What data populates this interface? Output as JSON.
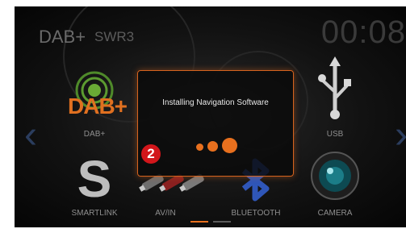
{
  "status_bar": {
    "source": "DAB+",
    "station": "SWR3",
    "time": "00:08"
  },
  "apps": {
    "dab": {
      "logo_text": "DAB+",
      "label": "DAB+"
    },
    "usb": {
      "label": "USB"
    },
    "smartlink": {
      "label": "SMARTLINK"
    },
    "avin": {
      "label": "AV/IN"
    },
    "bluetooth": {
      "label": "BLUETOOTH"
    },
    "camera": {
      "label": "CAMERA"
    }
  },
  "dialog": {
    "message": "Installing Navigation Software"
  },
  "callout": {
    "number": "2"
  },
  "colors": {
    "accent": "#e8701e",
    "badge": "#d2161b",
    "arrow": "#2b3d5e"
  }
}
